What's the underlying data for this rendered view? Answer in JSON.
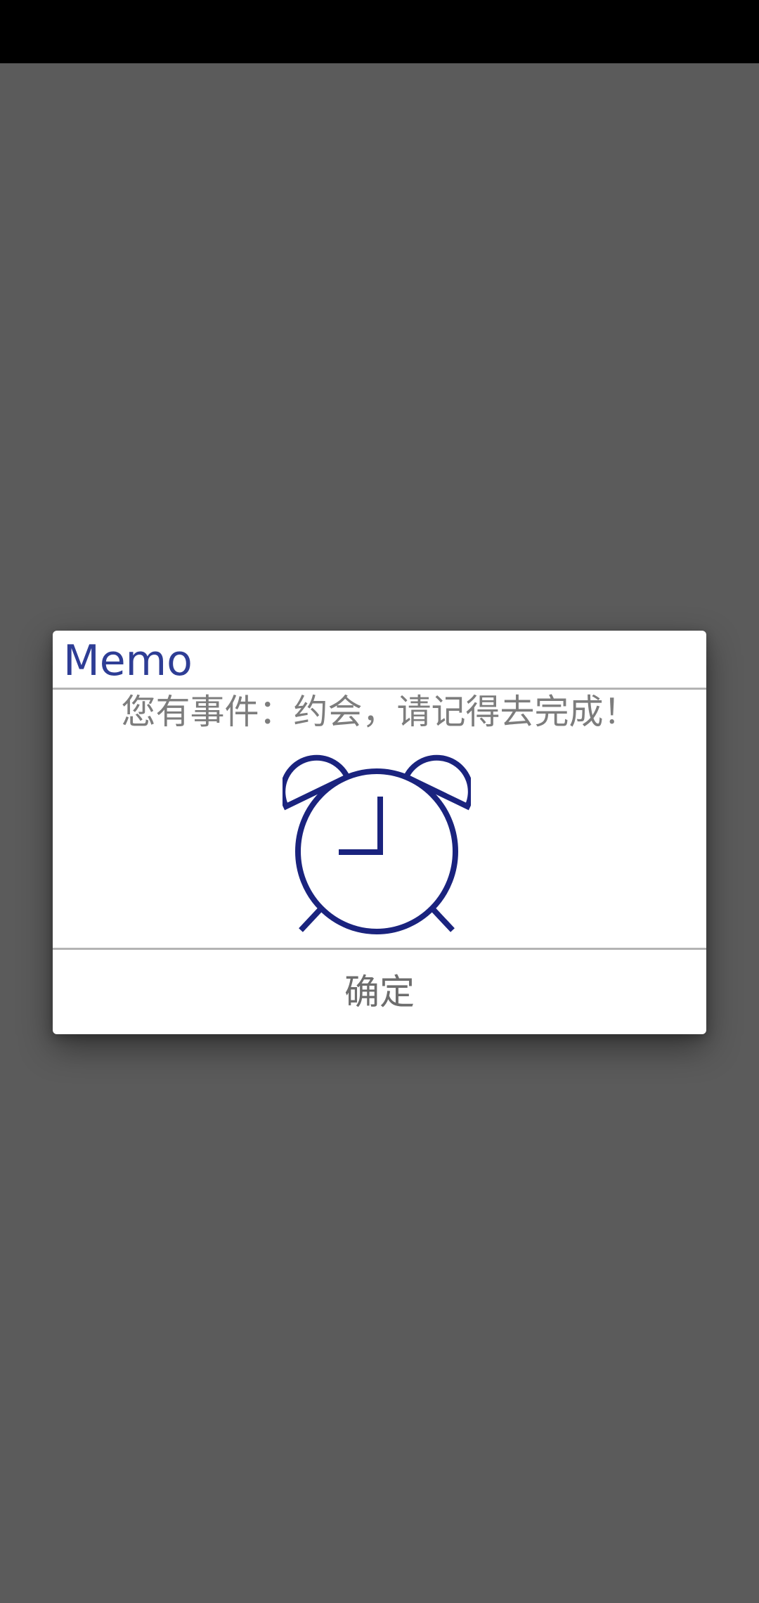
{
  "status_bar": {},
  "dialog": {
    "title": "Memo",
    "message": "您有事件：约会，请记得去完成！",
    "icon": "alarm-clock-icon",
    "confirm_label": "确定"
  },
  "colors": {
    "background_dim": "#5b5b5b",
    "status_bar": "#000000",
    "dialog_bg": "#ffffff",
    "title": "#2e3d95",
    "icon": "#1a237e",
    "message_text": "#7d7d7d",
    "button_text": "#6d6d6d",
    "divider": "#b4b4b4"
  }
}
